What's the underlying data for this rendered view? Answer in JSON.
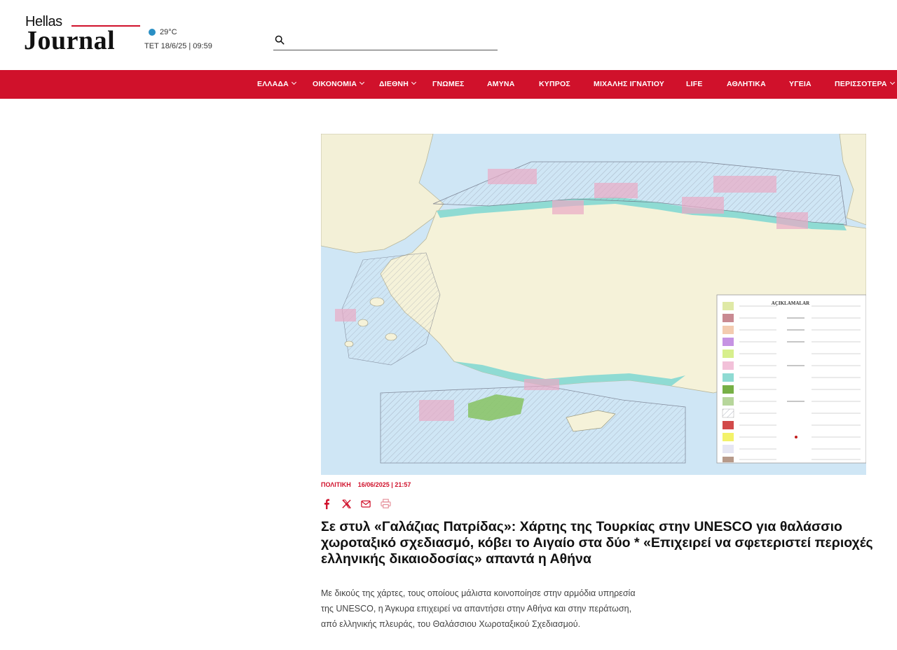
{
  "header": {
    "logo_top": "Hellas",
    "logo_main": "Journal",
    "weather": {
      "temp": "29°C",
      "datetime": "ΤΕΤ 18/6/25 | 09:59"
    },
    "search": {
      "placeholder": ""
    }
  },
  "nav": {
    "items": [
      {
        "label": "ΕΛΛΑΔΑ",
        "dropdown": true
      },
      {
        "label": "ΟΙΚΟΝΟΜΙΑ",
        "dropdown": true
      },
      {
        "label": "ΔΙΕΘΝΗ",
        "dropdown": true
      },
      {
        "label": "ΓΝΩΜΕΣ",
        "dropdown": false
      },
      {
        "label": "ΑΜΥΝΑ",
        "dropdown": false
      },
      {
        "label": "ΚΥΠΡΟΣ",
        "dropdown": false
      },
      {
        "label": "ΜΙΧΑΛΗΣ ΙΓΝΑΤΙΟΥ",
        "dropdown": false
      },
      {
        "label": "LIFE",
        "dropdown": false
      },
      {
        "label": "ΑΘΛΗΤΙΚΑ",
        "dropdown": false
      },
      {
        "label": "ΥΓΕΙΑ",
        "dropdown": false
      },
      {
        "label": "ΠΕΡΙΣΣΟΤΕΡΑ",
        "dropdown": true
      }
    ]
  },
  "article": {
    "category": "ΠΟΛΙΤΙΚΗ",
    "date": "16/06/2025 | 21:57",
    "share_icons": [
      "facebook-icon",
      "x-icon",
      "email-icon",
      "print-icon"
    ],
    "title": "Σε στυλ «Γαλάζιας Πατρίδας»: Χάρτης της Τουρκίας στην UNESCO για θαλάσσιο χωροταξικό σχεδιασμό, κόβει το Αιγαίο στα δύο * «Επιχειρεί να σφετεριστεί περιοχές ελληνικής δικαιοδοσίας» απαντά η Αθήνα",
    "lead": "Με δικούς της χάρτες, τους οποίους μάλιστα κοινοποίησε στην αρμόδια υπηρεσία της UNESCO, η Άγκυρα επιχειρεί να απαντήσει στην Αθήνα και στην περάτωση, από ελληνικής πλευράς, του Θαλάσσιου Χωροταξικού Σχεδιασμού.",
    "map_legend_title": "AÇIKLAMALAR"
  },
  "colors": {
    "brand_red": "#d0112b",
    "sea": "#cfe6f5",
    "land": "#f3f0d7"
  }
}
